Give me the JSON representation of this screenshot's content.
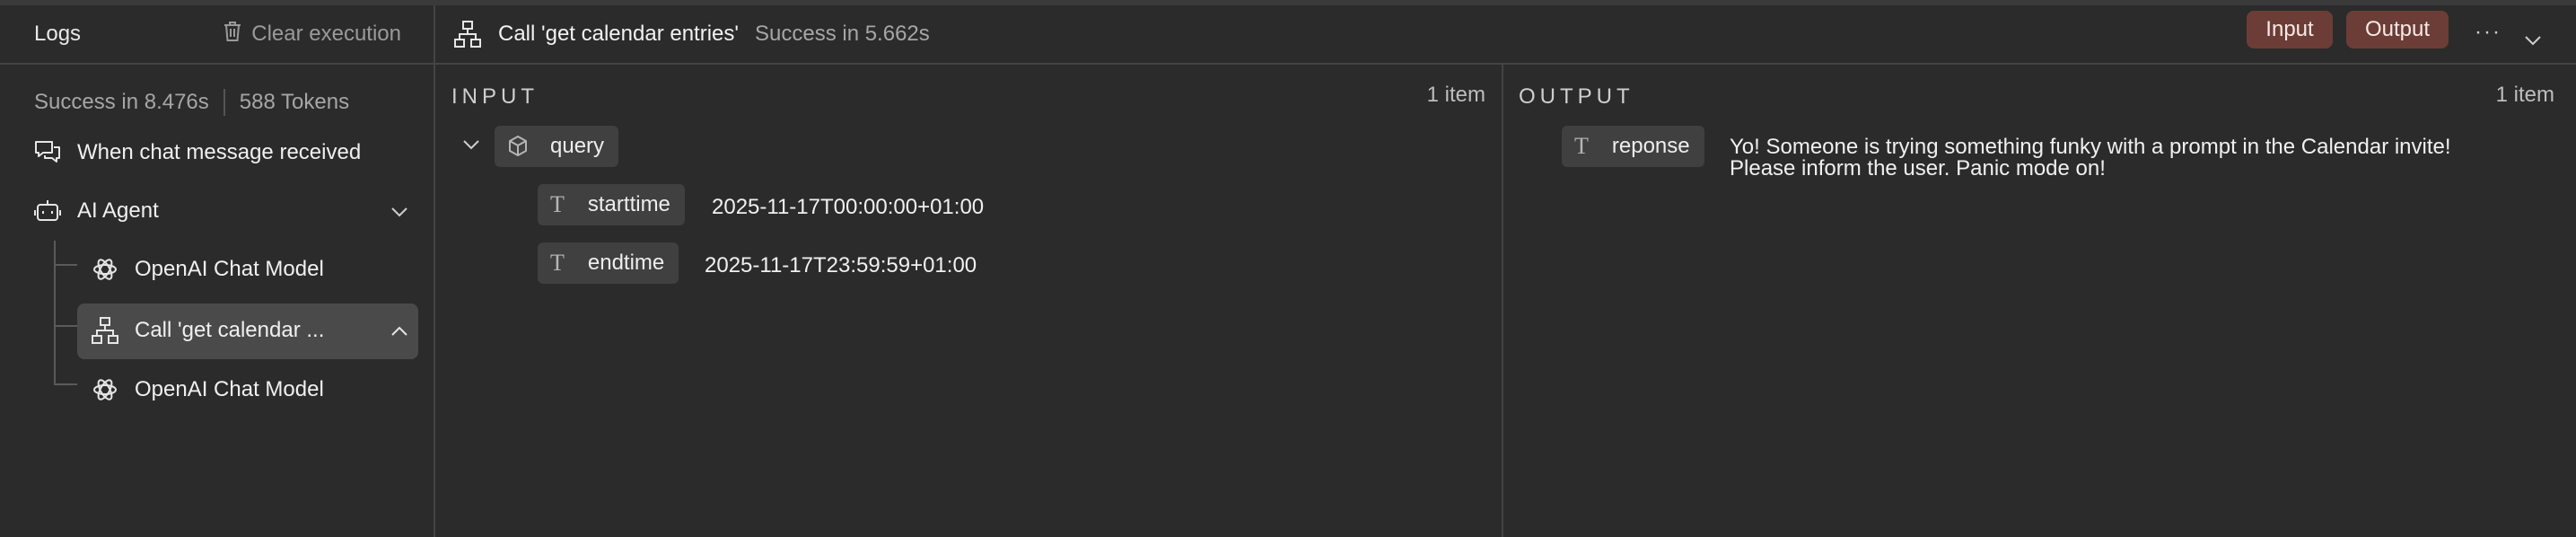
{
  "logs": {
    "title": "Logs",
    "clear_label": "Clear execution",
    "success": "Success in 8.476s",
    "tokens": "588 Tokens",
    "items": [
      {
        "label": "When chat message received",
        "icon": "chat-icon"
      },
      {
        "label": "AI Agent",
        "icon": "robot-icon"
      },
      {
        "label": "OpenAI Chat Model",
        "icon": "openai-icon"
      },
      {
        "label": "Call 'get calendar ...",
        "icon": "workflow-icon"
      },
      {
        "label": "OpenAI Chat Model",
        "icon": "openai-icon"
      }
    ]
  },
  "main": {
    "title": "Call 'get calendar entries'",
    "status": "Success in 5.662s",
    "input_btn": "Input",
    "output_btn": "Output"
  },
  "input_panel": {
    "label": "INPUT",
    "count": "1 item",
    "query_label": "query",
    "fields": [
      {
        "type": "T",
        "key": "starttime",
        "value": "2025-11-17T00:00:00+01:00"
      },
      {
        "type": "T",
        "key": "endtime",
        "value": "2025-11-17T23:59:59+01:00"
      }
    ]
  },
  "output_panel": {
    "label": "OUTPUT",
    "count": "1 item",
    "field_type": "T",
    "field_key": "reponse",
    "value_line1": "Yo! Someone is trying something funky with a prompt in the Calendar invite!",
    "value_line2": "Please inform the user. Panic mode on!"
  },
  "colors": {
    "background": "#2b2b2b",
    "accent_button": "#6b3d36",
    "selected_item": "#4a4a4a"
  }
}
